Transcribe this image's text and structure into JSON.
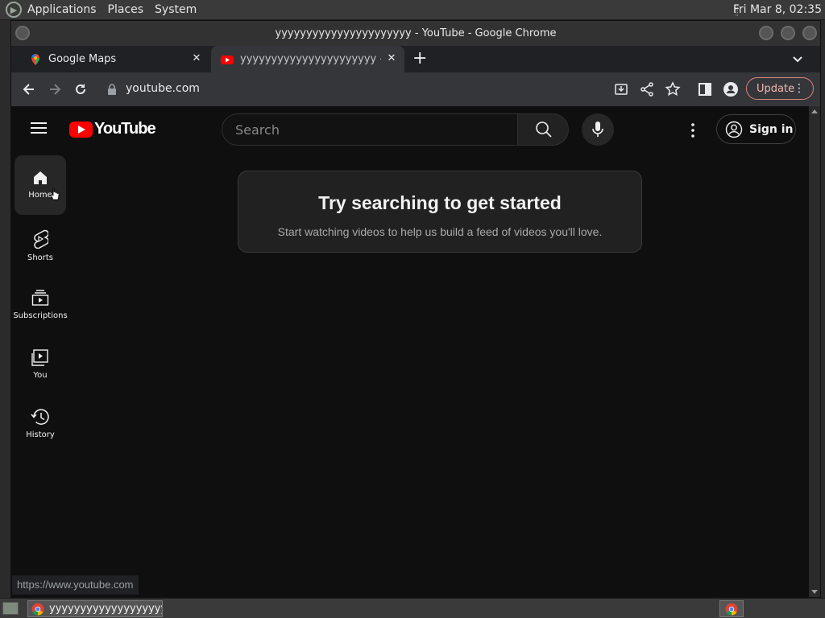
{
  "system_panel": {
    "menus": [
      "Applications",
      "Places",
      "System"
    ],
    "clock": "Fri Mar  8, 02:35"
  },
  "window": {
    "title": "yyyyyyyyyyyyyyyyyyyyyy - YouTube - Google Chrome"
  },
  "tabs": [
    {
      "title": "Google Maps",
      "icon": "maps-pin-icon"
    },
    {
      "title": "yyyyyyyyyyyyyyyyyyyyyy - YouTube",
      "icon": "youtube-icon",
      "active": true
    }
  ],
  "toolbar": {
    "url": "youtube.com",
    "update_label": "Update"
  },
  "youtube": {
    "logo_text": "YouTube",
    "search_placeholder": "Search",
    "sign_in_label": "Sign in",
    "guide": [
      {
        "label": "Home",
        "icon": "home-icon"
      },
      {
        "label": "Shorts",
        "icon": "shorts-icon"
      },
      {
        "label": "Subscriptions",
        "icon": "subscriptions-icon"
      },
      {
        "label": "You",
        "icon": "you-icon"
      },
      {
        "label": "History",
        "icon": "history-icon"
      }
    ],
    "empty_state": {
      "title": "Try searching to get started",
      "subtitle": "Start watching videos to help us build a feed of videos you'll love."
    }
  },
  "status_bar": {
    "url": "https://www.youtube.com"
  },
  "taskbar": {
    "window_label": "yyyyyyyyyyyyyyyyyyyy..."
  },
  "colors": {
    "youtube_red": "#ff0000",
    "page_bg": "#0f0f0f",
    "update_accent": "#d6867a"
  }
}
